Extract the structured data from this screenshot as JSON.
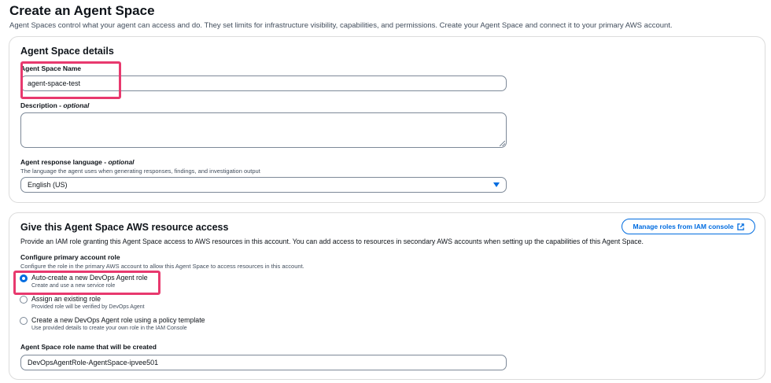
{
  "page": {
    "title": "Create an Agent Space",
    "description": "Agent Spaces control what your agent can access and do. They set limits for infrastructure visibility, capabilities, and permissions. Create your Agent Space and connect it to your primary AWS account."
  },
  "details": {
    "title": "Agent Space details",
    "name_label": "Agent Space Name",
    "name_value": "agent-space-test",
    "description_label": "Description",
    "optional_suffix": "optional",
    "description_value": "",
    "language_label": "Agent response language",
    "language_hint": "The language the agent uses when generating responses, findings, and investigation output",
    "language_value": "English (US)"
  },
  "access": {
    "title": "Give this Agent Space AWS resource access",
    "manage_button": "Manage roles from IAM console",
    "description": "Provide an IAM role granting this Agent Space access to AWS resources in this account. You can add access to resources in secondary AWS accounts when setting up the capabilities of this Agent Space.",
    "role_label": "Configure primary account role",
    "role_hint": "Configure the role in the primary AWS account to allow this Agent Space to access resources in this account.",
    "options": [
      {
        "label": "Auto-create a new DevOps Agent role",
        "sub": "Create and use a new service role",
        "checked": true
      },
      {
        "label": "Assign an existing role",
        "sub": "Provided role will be verified by DevOps Agent",
        "checked": false
      },
      {
        "label": "Create a new DevOps Agent role using a policy template",
        "sub": "Use provided details to create your own role in the IAM Console",
        "checked": false
      }
    ],
    "role_name_label": "Agent Space role name that will be created",
    "role_name_value": "DevOpsAgentRole-AgentSpace-ipvee501"
  },
  "colors": {
    "accent": "#006ce0",
    "highlight": "#e8396e"
  }
}
